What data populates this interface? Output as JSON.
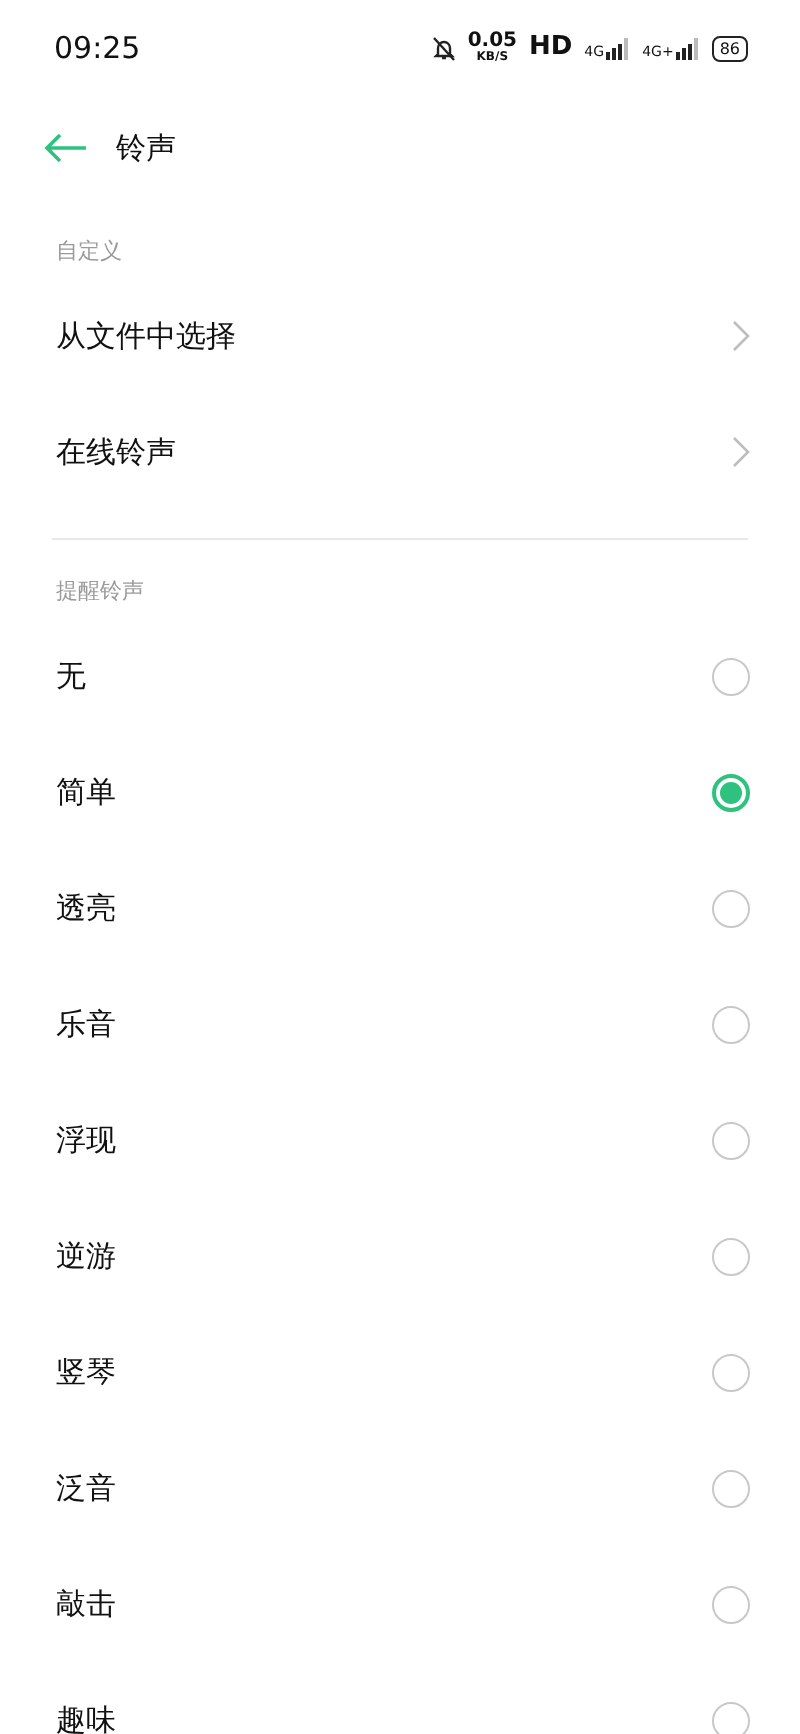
{
  "status_bar": {
    "time": "09:25",
    "speed": "0.05",
    "speed_unit": "KB/S",
    "hd": "HD",
    "network_1": "4G",
    "network_2": "4G+",
    "battery": "86"
  },
  "header": {
    "title": "铃声"
  },
  "sections": [
    {
      "title": "自定义",
      "items": [
        {
          "kind": "link",
          "label": "从文件中选择"
        },
        {
          "kind": "link",
          "label": "在线铃声"
        }
      ]
    },
    {
      "title": "提醒铃声",
      "items": [
        {
          "kind": "radio",
          "label": "无",
          "selected": false
        },
        {
          "kind": "radio",
          "label": "简单",
          "selected": true
        },
        {
          "kind": "radio",
          "label": "透亮",
          "selected": false
        },
        {
          "kind": "radio",
          "label": "乐音",
          "selected": false
        },
        {
          "kind": "radio",
          "label": "浮现",
          "selected": false
        },
        {
          "kind": "radio",
          "label": "逆游",
          "selected": false
        },
        {
          "kind": "radio",
          "label": "竖琴",
          "selected": false
        },
        {
          "kind": "radio",
          "label": "泛音",
          "selected": false
        },
        {
          "kind": "radio",
          "label": "敲击",
          "selected": false
        },
        {
          "kind": "radio",
          "label": "趣味",
          "selected": false
        }
      ]
    }
  ]
}
